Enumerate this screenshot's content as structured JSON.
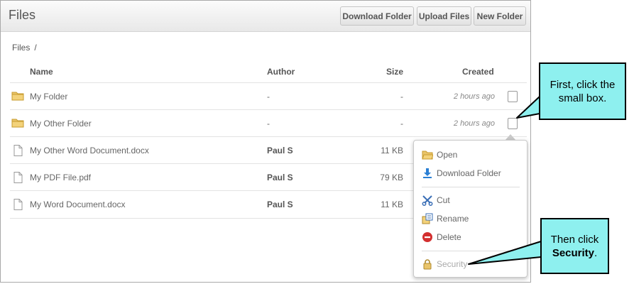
{
  "header": {
    "title": "Files",
    "buttons": [
      "Download Folder",
      "Upload Files",
      "New Folder"
    ]
  },
  "breadcrumb": {
    "root": "Files",
    "separator": "/"
  },
  "columns": {
    "name": "Name",
    "author": "Author",
    "size": "Size",
    "created": "Created"
  },
  "rows": [
    {
      "type": "folder",
      "name": "My Folder",
      "author": "-",
      "size": "-",
      "created": "2 hours ago"
    },
    {
      "type": "folder",
      "name": "My Other Folder",
      "author": "-",
      "size": "-",
      "created": "2 hours ago"
    },
    {
      "type": "file",
      "name": "My Other Word Document.docx",
      "author": "Paul S",
      "size": "11 KB",
      "created": ""
    },
    {
      "type": "file",
      "name": "My PDF File.pdf",
      "author": "Paul S",
      "size": "79 KB",
      "created": ""
    },
    {
      "type": "file",
      "name": "My Word Document.docx",
      "author": "Paul S",
      "size": "11 KB",
      "created": ""
    }
  ],
  "context_menu": {
    "items": [
      {
        "label": "Open",
        "icon": "folder-icon"
      },
      {
        "label": "Download Folder",
        "icon": "download-icon"
      },
      {
        "label": "Cut",
        "icon": "scissors-icon"
      },
      {
        "label": "Rename",
        "icon": "rename-icon"
      },
      {
        "label": "Delete",
        "icon": "delete-icon"
      },
      {
        "label": "Security",
        "icon": "lock-icon"
      }
    ]
  },
  "callouts": {
    "first": "First, click the small box.",
    "second_prefix": "Then click",
    "second_bold": "Security",
    "second_suffix": "."
  },
  "colors": {
    "callout_fill": "#8ef0ef",
    "folder": "#e9c46a",
    "delete": "#d32f2f",
    "download": "#2a7fd4"
  }
}
